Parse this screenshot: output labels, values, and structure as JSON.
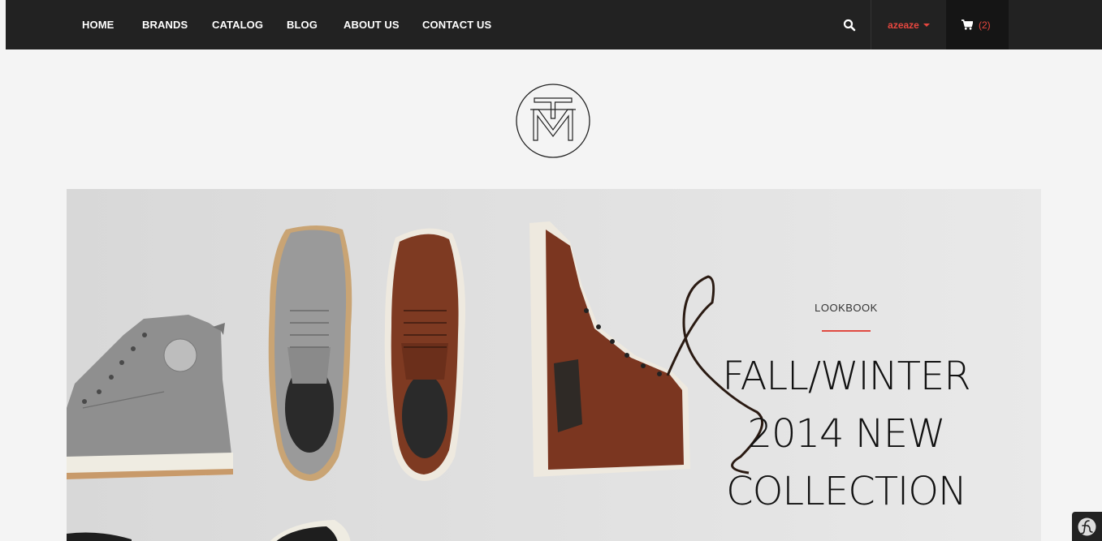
{
  "nav": {
    "items": [
      {
        "label": "HOME"
      },
      {
        "label": "BRANDS"
      },
      {
        "label": "CATALOG"
      },
      {
        "label": "BLOG"
      },
      {
        "label": "ABOUT US"
      },
      {
        "label": "CONTACT US"
      }
    ],
    "search_icon": "search-icon",
    "user": {
      "name": "azeaze",
      "icon": "caret-down-icon"
    },
    "cart": {
      "icon": "shopping-cart-icon",
      "count": "(2)"
    }
  },
  "logo": {
    "letters": "TM"
  },
  "hero": {
    "tag": "LOOKBOOK",
    "title_lines": [
      "FALL/WINTER",
      "2014 NEW",
      "COLLECTION"
    ]
  },
  "badge": {
    "icon": "symfony-icon"
  },
  "colors": {
    "nav_bg": "#222222",
    "accent": "#e8473f",
    "page_bg": "#f4f4f4",
    "hero_bg": "#e4e4e4"
  }
}
